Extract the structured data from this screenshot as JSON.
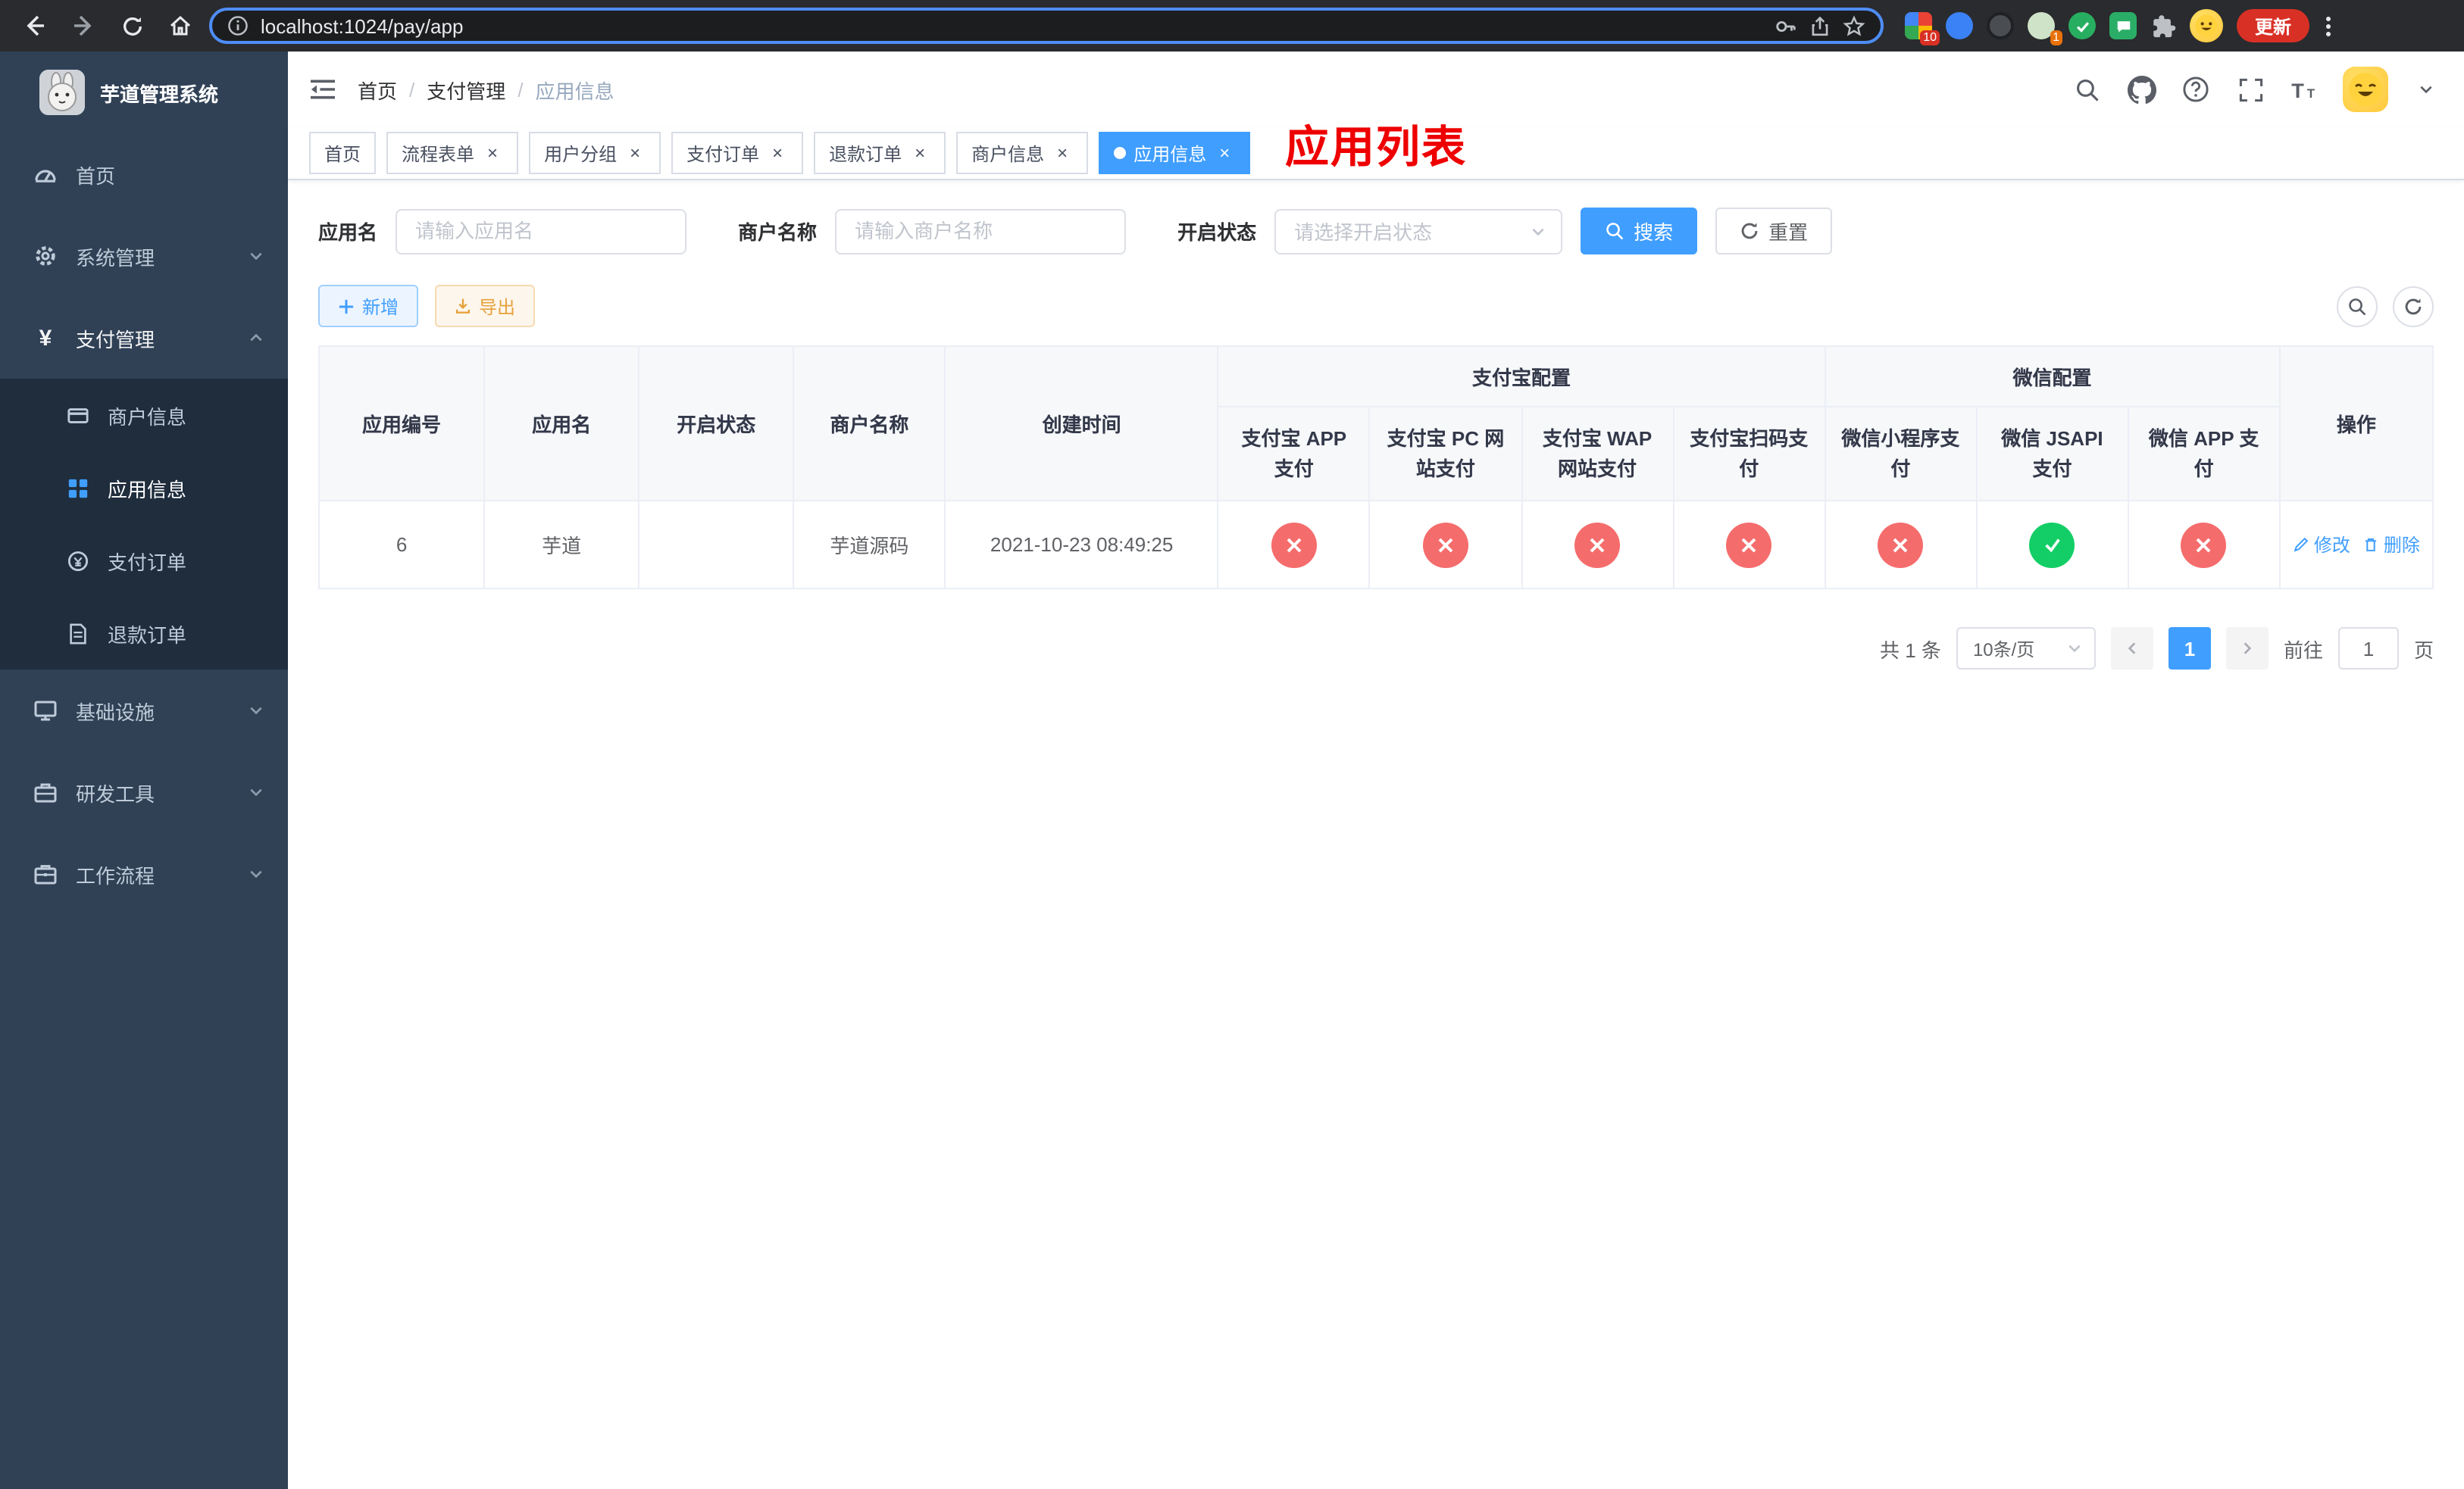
{
  "ui": {
    "close_glyph": "×"
  },
  "browser": {
    "url": "localhost:1024/pay/app",
    "update_label": "更新",
    "ext_badge_multi": "10",
    "ext_badge_tan": "1"
  },
  "sidebar": {
    "title": "芋道管理系统",
    "home": "首页",
    "system": "系统管理",
    "payment": "支付管理",
    "merchant_info": "商户信息",
    "app_info": "应用信息",
    "pay_order": "支付订单",
    "refund_order": "退款订单",
    "infra": "基础设施",
    "dev_tools": "研发工具",
    "workflow": "工作流程"
  },
  "breadcrumb": {
    "items": [
      "首页",
      "支付管理",
      "应用信息"
    ],
    "separator": "/"
  },
  "page_title": "应用列表",
  "tabs": [
    {
      "label": "首页",
      "closable": false,
      "active": false
    },
    {
      "label": "流程表单",
      "closable": true,
      "active": false
    },
    {
      "label": "用户分组",
      "closable": true,
      "active": false
    },
    {
      "label": "支付订单",
      "closable": true,
      "active": false
    },
    {
      "label": "退款订单",
      "closable": true,
      "active": false
    },
    {
      "label": "商户信息",
      "closable": true,
      "active": false
    },
    {
      "label": "应用信息",
      "closable": true,
      "active": true
    }
  ],
  "filters": {
    "app_name_label": "应用名",
    "app_name_placeholder": "请输入应用名",
    "merchant_label": "商户名称",
    "merchant_placeholder": "请输入商户名称",
    "status_label": "开启状态",
    "status_placeholder": "请选择开启状态",
    "search_button": "搜索",
    "reset_button": "重置"
  },
  "toolbar": {
    "add_label": "新增",
    "export_label": "导出"
  },
  "table": {
    "group_alipay": "支付宝配置",
    "group_wechat": "微信配置",
    "col_app_id": "应用编号",
    "col_app_name": "应用名",
    "col_status": "开启状态",
    "col_merchant": "商户名称",
    "col_created": "创建时间",
    "col_alipay_app": "支付宝 APP 支付",
    "col_alipay_pc": "支付宝 PC 网站支付",
    "col_alipay_wap": "支付宝 WAP 网站支付",
    "col_alipay_scan": "支付宝扫码支付",
    "col_wx_mini": "微信小程序支付",
    "col_wx_jsapi": "微信 JSAPI 支付",
    "col_wx_app": "微信 APP 支付",
    "col_actions": "操作",
    "row": {
      "id": "6",
      "name": "芋道",
      "status_on": true,
      "merchant": "芋道源码",
      "created": "2021-10-23 08:49:25",
      "alipay_app": false,
      "alipay_pc": false,
      "alipay_wap": false,
      "alipay_scan": false,
      "wx_mini": false,
      "wx_jsapi": true,
      "wx_app": false,
      "edit_label": "修改",
      "delete_label": "删除"
    }
  },
  "pagination": {
    "total": "共 1 条",
    "page_size": "10条/页",
    "page": "1",
    "goto_label": "前往",
    "goto_value": "1",
    "unit_label": "页"
  },
  "colors": {
    "primary": "#409eff",
    "danger": "#f56c6c",
    "success": "#13ce66",
    "sidebar_bg": "#304156",
    "submenu_bg": "#1f2d3d",
    "title_red": "#ee0000"
  }
}
